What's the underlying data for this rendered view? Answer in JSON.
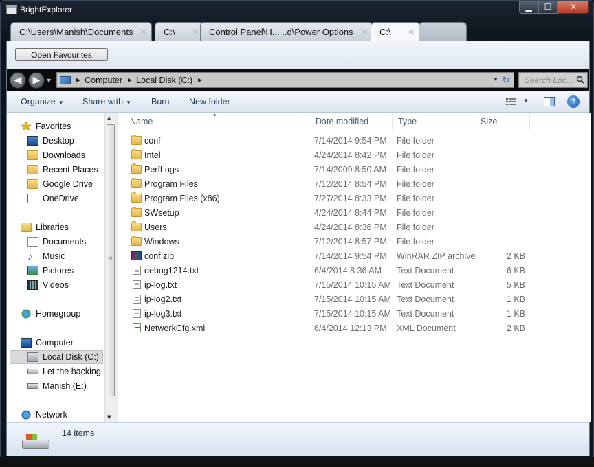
{
  "window": {
    "title": "BrightExplorer"
  },
  "tabs": [
    {
      "label": "C:\\Users\\Manish\\Documents",
      "active": false
    },
    {
      "label": "C:\\",
      "active": false
    },
    {
      "label": "Control Panel\\H... ..d\\Power Options",
      "active": false
    },
    {
      "label": "C:\\",
      "active": true
    }
  ],
  "favourites_button": "Open Favourites",
  "address": {
    "crumbs": [
      "Computer",
      "Local Disk (C:)"
    ]
  },
  "search": {
    "placeholder": "Search Loc..."
  },
  "command_bar": {
    "organize": "Organize",
    "share_with": "Share with",
    "burn": "Burn",
    "new_folder": "New folder"
  },
  "nav": {
    "favorites": "Favorites",
    "fav_items": [
      "Desktop",
      "Downloads",
      "Recent Places",
      "Google Drive",
      "OneDrive"
    ],
    "libraries": "Libraries",
    "lib_items": [
      "Documents",
      "Music",
      "Pictures",
      "Videos"
    ],
    "homegroup": "Homegroup",
    "computer": "Computer",
    "drives": [
      "Local Disk (C:)",
      "Let the hacking b",
      "Manish (E:)"
    ],
    "network": "Network"
  },
  "columns": {
    "name": "Name",
    "date": "Date modified",
    "type": "Type",
    "size": "Size"
  },
  "files": [
    {
      "name": "conf",
      "date": "7/14/2014 9:54 PM",
      "type": "File folder",
      "size": "",
      "icon": "folder-icon"
    },
    {
      "name": "Intel",
      "date": "4/24/2014 8:42 PM",
      "type": "File folder",
      "size": "",
      "icon": "folder-icon"
    },
    {
      "name": "PerfLogs",
      "date": "7/14/2009 8:50 AM",
      "type": "File folder",
      "size": "",
      "icon": "folder-icon"
    },
    {
      "name": "Program Files",
      "date": "7/12/2014 8:54 PM",
      "type": "File folder",
      "size": "",
      "icon": "folder-icon"
    },
    {
      "name": "Program Files (x86)",
      "date": "7/27/2014 8:33 PM",
      "type": "File folder",
      "size": "",
      "icon": "folder-icon"
    },
    {
      "name": "SWsetup",
      "date": "4/24/2014 8:44 PM",
      "type": "File folder",
      "size": "",
      "icon": "folder-icon"
    },
    {
      "name": "Users",
      "date": "4/24/2014 8:36 PM",
      "type": "File folder",
      "size": "",
      "icon": "folder-icon"
    },
    {
      "name": "Windows",
      "date": "7/12/2014 8:57 PM",
      "type": "File folder",
      "size": "",
      "icon": "folder-icon"
    },
    {
      "name": "conf.zip",
      "date": "7/14/2014 9:54 PM",
      "type": "WinRAR ZIP archive",
      "size": "2 KB",
      "icon": "zip-icon"
    },
    {
      "name": "debug1214.txt",
      "date": "6/4/2014 8:36 AM",
      "type": "Text Document",
      "size": "6 KB",
      "icon": "text-file-icon"
    },
    {
      "name": "ip-log.txt",
      "date": "7/15/2014 10:15 AM",
      "type": "Text Document",
      "size": "5 KB",
      "icon": "text-file-icon"
    },
    {
      "name": "ip-log2.txt",
      "date": "7/15/2014 10:15 AM",
      "type": "Text Document",
      "size": "1 KB",
      "icon": "text-file-icon"
    },
    {
      "name": "ip-log3.txt",
      "date": "7/15/2014 10:15 AM",
      "type": "Text Document",
      "size": "1 KB",
      "icon": "text-file-icon"
    },
    {
      "name": "NetworkCfg.xml",
      "date": "6/4/2014 12:13 PM",
      "type": "XML Document",
      "size": "2 KB",
      "icon": "xml-file-icon"
    }
  ],
  "status": {
    "item_count": "14 items"
  }
}
